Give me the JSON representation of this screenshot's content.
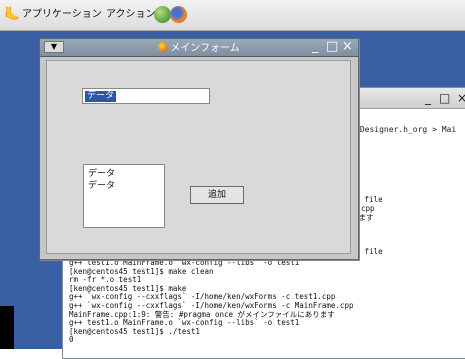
{
  "top_panel": {
    "menu_apps": "アプリケーション",
    "menu_actions": "アクション",
    "icons": [
      "gnome-foot-icon",
      "network-globe-icon",
      "firefox-icon"
    ]
  },
  "form_window": {
    "title": "メインフォーム",
    "text_field_value": "データ",
    "list_items": [
      "データ",
      "データ"
    ],
    "add_button_label": "追加",
    "controls": {
      "minimize": "_",
      "maximize": "□",
      "close": "×"
    }
  },
  "terminal": {
    "controls": {
      "minimize": "_",
      "maximize": "□",
      "close": "×"
    },
    "menu_partial": ",Designer.h_org > Mai",
    "fragments": [
      "of file",
      "cpp",
      "ります",
      "of file"
    ],
    "lines": [
      "g++ test1.o MainFrame.o `wx-config --libs` -o test1",
      "[ken@centos45 test1]$ make clean",
      "rm -fr *.o test1",
      "[ken@centos45 test1]$ make",
      "g++ `wx-config --cxxflags` -I/home/ken/wxForms -c test1.cpp",
      "g++ `wx-config --cxxflags` -I/home/ken/wxForms -c MainFrame.cpp",
      "MainFrame.cpp:1:9: 警告: #pragma once がメインファイルにあります",
      "g++ test1.o MainFrame.o `wx-config --libs` -o test1",
      "[ken@centos45 test1]$ ./test1",
      "0"
    ]
  },
  "colors": {
    "desktop": "#3b5fa3",
    "form_title": "#8797a8",
    "selection": "#2f54a8"
  }
}
